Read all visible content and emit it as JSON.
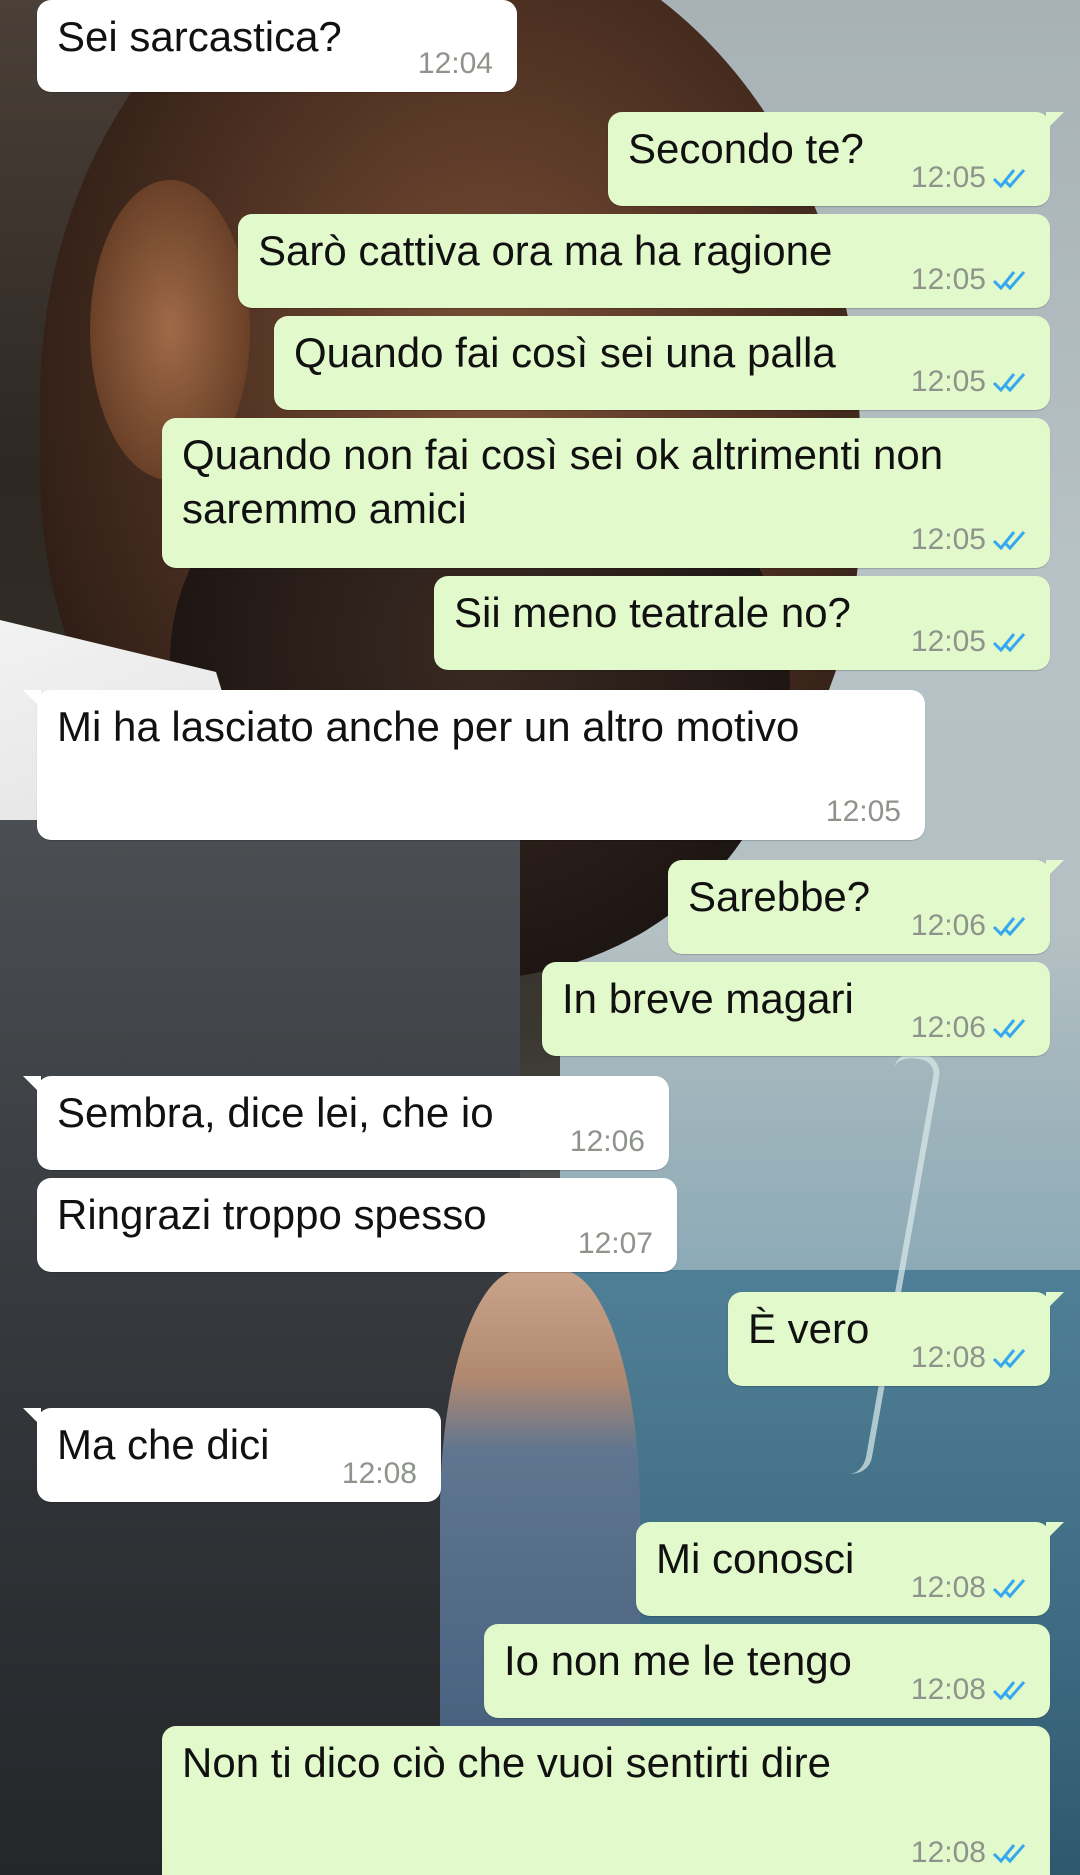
{
  "app": "WhatsApp",
  "colors": {
    "incoming_bubble": "#ffffff",
    "outgoing_bubble": "#e2f9cb",
    "read_ticks": "#35a8f0",
    "timestamp": "#8e938c"
  },
  "messages": [
    {
      "direction": "in",
      "text": "Sei sarcastica?",
      "time": "12:04"
    },
    {
      "direction": "out",
      "text": "Secondo te?",
      "time": "12:05",
      "status": "read"
    },
    {
      "direction": "out",
      "text": "Sarò cattiva ora ma ha ragione",
      "time": "12:05",
      "status": "read"
    },
    {
      "direction": "out",
      "text": "Quando fai così sei una palla",
      "time": "12:05",
      "status": "read"
    },
    {
      "direction": "out",
      "text": "Quando non fai così sei ok altrimenti non saremmo amici",
      "time": "12:05",
      "status": "read"
    },
    {
      "direction": "out",
      "text": "Sii meno teatrale no?",
      "time": "12:05",
      "status": "read"
    },
    {
      "direction": "in",
      "text": "Mi ha lasciato anche per un altro motivo",
      "time": "12:05"
    },
    {
      "direction": "out",
      "text": "Sarebbe?",
      "time": "12:06",
      "status": "read"
    },
    {
      "direction": "out",
      "text": "In breve magari",
      "time": "12:06",
      "status": "read"
    },
    {
      "direction": "in",
      "text": "Sembra, dice lei, che io",
      "time": "12:06"
    },
    {
      "direction": "in",
      "text": "Ringrazi troppo spesso",
      "time": "12:07"
    },
    {
      "direction": "out",
      "text": "È vero",
      "time": "12:08",
      "status": "read"
    },
    {
      "direction": "in",
      "text": "Ma che dici",
      "time": "12:08"
    },
    {
      "direction": "out",
      "text": "Mi conosci",
      "time": "12:08",
      "status": "read"
    },
    {
      "direction": "out",
      "text": "Io non me le tengo",
      "time": "12:08",
      "status": "read"
    },
    {
      "direction": "out",
      "text": "Non ti dico ciò che vuoi sentirti dire",
      "time": "12:08",
      "status": "read"
    }
  ]
}
